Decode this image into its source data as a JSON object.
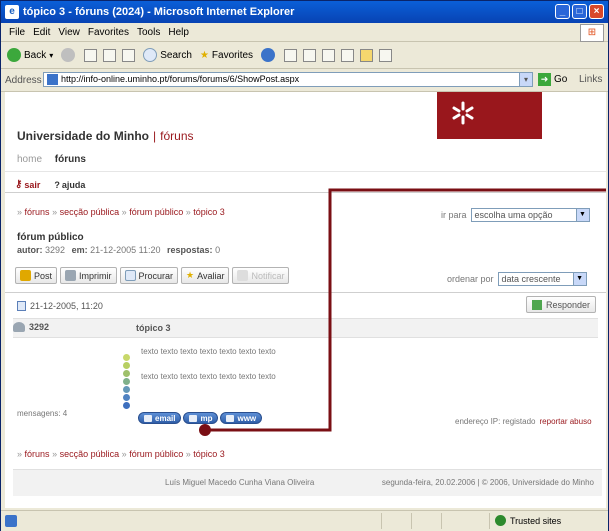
{
  "window": {
    "title": "tópico 3 - fóruns (2024) - Microsoft Internet Explorer"
  },
  "menu": [
    "File",
    "Edit",
    "View",
    "Favorites",
    "Tools",
    "Help"
  ],
  "toolbar": {
    "back": "Back",
    "search": "Search",
    "favorites": "Favorites"
  },
  "address": {
    "label": "Address",
    "url": "http://info-online.uminho.pt/forums/forums/6/ShowPost.aspx",
    "go": "Go",
    "links": "Links"
  },
  "site": {
    "name": "Universidade do Minho",
    "section": "fóruns"
  },
  "tabs": {
    "home": "home",
    "foruns": "fóruns"
  },
  "actions": {
    "sair": "sair",
    "ajuda": "ajuda"
  },
  "breadcrumb": {
    "foruns": "fóruns",
    "seccao": "secção pública",
    "forum": "fórum público",
    "topico": "tópico 3",
    "sep": "»"
  },
  "irpara": {
    "label": "ir para",
    "value": "escolha uma opção"
  },
  "forum": {
    "title": "fórum público",
    "meta_autor_label": "autor:",
    "meta_autor": "3292",
    "meta_em_label": "em:",
    "meta_em": "21-12-2005 11:20",
    "meta_resp_label": "respostas:",
    "meta_resp": "0"
  },
  "buttons": {
    "post": "Post",
    "imprimir": "Imprimir",
    "procurar": "Procurar",
    "avaliar": "Avaliar",
    "notificar": "Notificar"
  },
  "ordenar": {
    "label": "ordenar por",
    "value": "data crescente"
  },
  "post": {
    "date": "21-12-2005, 11:20",
    "reply": "Responder",
    "user": "3292",
    "topic": "tópico 3",
    "line1": "texto texto texto texto texto texto texto",
    "line2": "texto texto texto texto texto texto texto",
    "mensagens": "mensagens: 4",
    "pill_email": "email",
    "pill_mp": "mp",
    "pill_www": "www",
    "ip": "endereço IP: registado",
    "report": "reportar abuso"
  },
  "footer": {
    "name": "Luís Miguel Macedo Cunha Viana Oliveira",
    "date": "segunda-feira, 20.02.2006 | © 2006, Universidade do Minho"
  },
  "status": {
    "zone": "Trusted sites"
  },
  "colors": {
    "brand": "#99171c",
    "titlebar": "#0a5fd8",
    "chrome": "#ece9d8"
  }
}
